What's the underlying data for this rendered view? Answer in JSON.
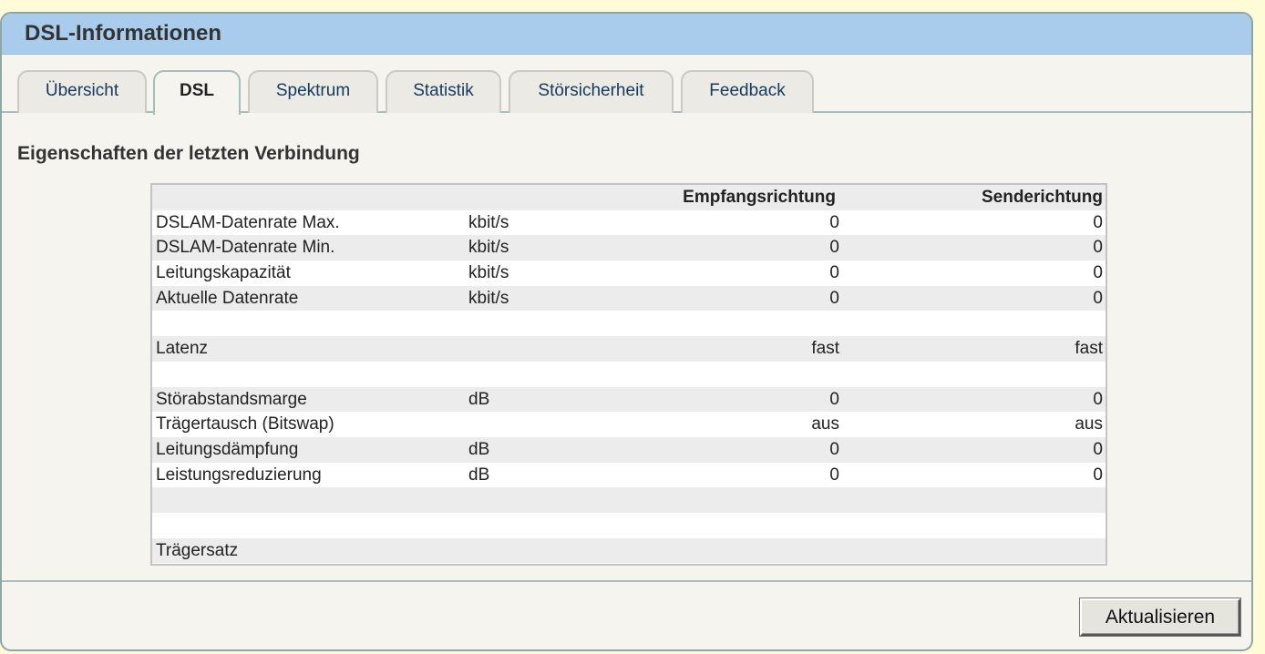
{
  "title": "DSL-Informationen",
  "tabs": [
    {
      "label": "Übersicht"
    },
    {
      "label": "DSL"
    },
    {
      "label": "Spektrum"
    },
    {
      "label": "Statistik"
    },
    {
      "label": "Störsicherheit"
    },
    {
      "label": "Feedback"
    }
  ],
  "active_tab": "DSL",
  "section_title": "Eigenschaften der letzten Verbindung",
  "table": {
    "headers": {
      "label": "",
      "unit": "",
      "rx": "Empfangsrichtung",
      "tx": "Senderichtung"
    },
    "rows": [
      {
        "label": "DSLAM-Datenrate Max.",
        "unit": "kbit/s",
        "rx": "0",
        "tx": "0"
      },
      {
        "label": "DSLAM-Datenrate Min.",
        "unit": "kbit/s",
        "rx": "0",
        "tx": "0"
      },
      {
        "label": "Leitungskapazität",
        "unit": "kbit/s",
        "rx": "0",
        "tx": "0"
      },
      {
        "label": "Aktuelle Datenrate",
        "unit": "kbit/s",
        "rx": "0",
        "tx": "0"
      },
      {
        "label": "",
        "unit": "",
        "rx": "",
        "tx": ""
      },
      {
        "label": "Latenz",
        "unit": "",
        "rx": "fast",
        "tx": "fast"
      },
      {
        "label": "",
        "unit": "",
        "rx": "",
        "tx": ""
      },
      {
        "label": "Störabstandsmarge",
        "unit": "dB",
        "rx": "0",
        "tx": "0"
      },
      {
        "label": "Trägertausch (Bitswap)",
        "unit": "",
        "rx": "aus",
        "tx": "aus"
      },
      {
        "label": "Leitungsdämpfung",
        "unit": "dB",
        "rx": "0",
        "tx": "0"
      },
      {
        "label": "Leistungsreduzierung",
        "unit": "dB",
        "rx": "0",
        "tx": "0"
      },
      {
        "label": "",
        "unit": "",
        "rx": "",
        "tx": ""
      },
      {
        "label": "",
        "unit": "",
        "rx": "",
        "tx": ""
      },
      {
        "label": "Trägersatz",
        "unit": "",
        "rx": "",
        "tx": ""
      }
    ]
  },
  "refresh_button": "Aktualisieren"
}
